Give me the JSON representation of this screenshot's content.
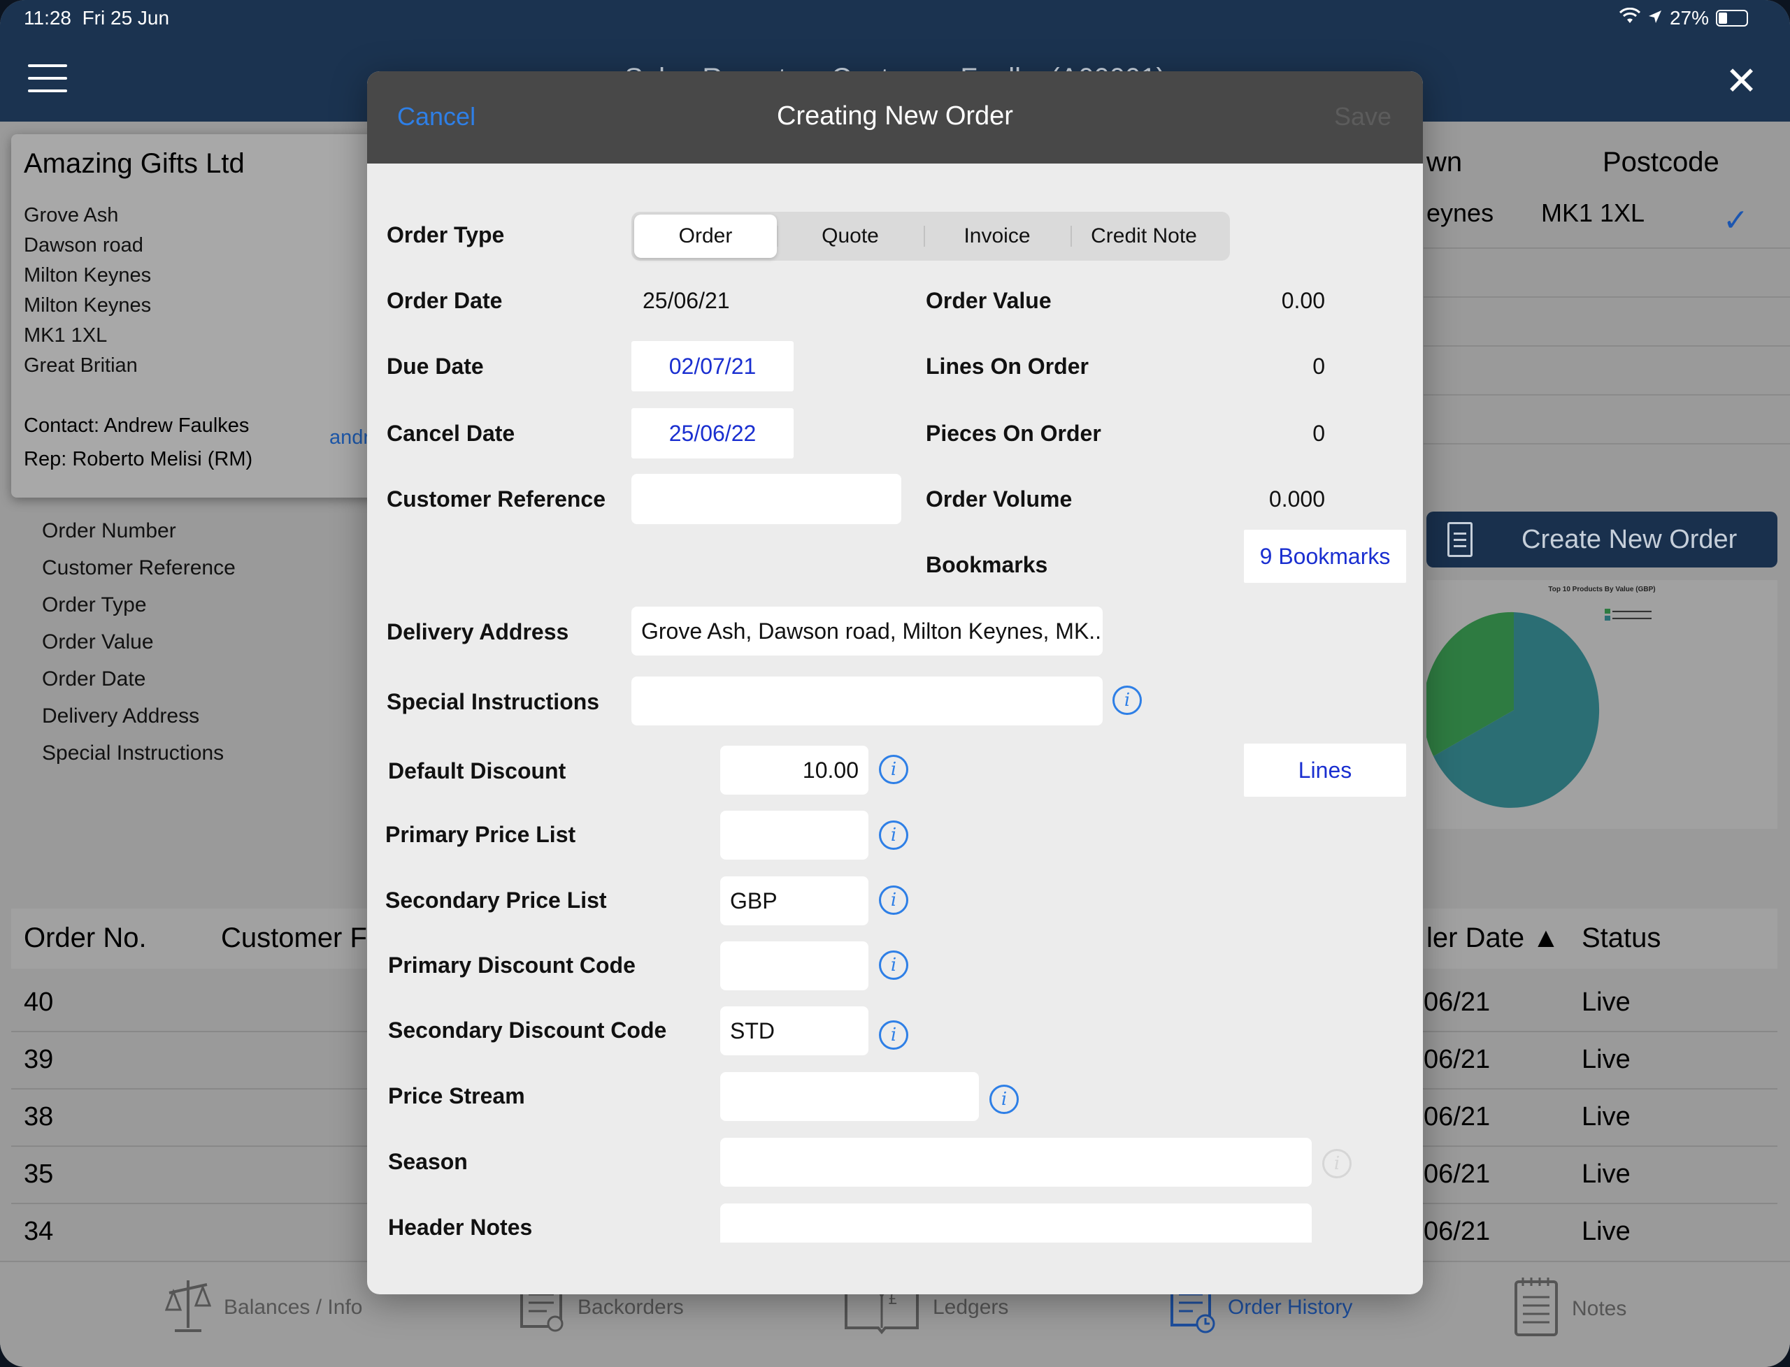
{
  "status_bar": {
    "time": "11:28",
    "date": "Fri 25 Jun",
    "battery": "27%"
  },
  "nav": {
    "title": "Sales Reports – Customer Faulks (A00001)"
  },
  "customer": {
    "name": "Amazing Gifts Ltd",
    "address_lines": [
      "Grove Ash",
      "Dawson road",
      "Milton Keynes",
      "Milton Keynes",
      "MK1 1XL",
      "Great Britian"
    ],
    "contact": "Contact: Andrew Faulkes",
    "email_partial": "andr",
    "rep": "Rep: Roberto Melisi (RM)"
  },
  "search_fields": [
    "Order Number",
    "Customer Reference",
    "Order Type",
    "Order Value",
    "Order Date",
    "Delivery Address",
    "Special Instructions"
  ],
  "address_table": {
    "town_header": "wn",
    "postcode_header": "Postcode",
    "town": "eynes",
    "postcode": "MK1 1XL"
  },
  "create_order_button": "Create New Order",
  "pie_chart": {
    "title": "Top 10 Products By Value (GBP)"
  },
  "orders_table": {
    "headers": {
      "order_no": "Order No.",
      "customer_ref": "Customer F",
      "order_date": "ler Date ▲",
      "status": "Status"
    },
    "rows": [
      {
        "no": "40",
        "date": "06/21",
        "status": "Live"
      },
      {
        "no": "39",
        "date": "06/21",
        "status": "Live"
      },
      {
        "no": "38",
        "date": "06/21",
        "status": "Live"
      },
      {
        "no": "35",
        "date": "06/21",
        "status": "Live"
      },
      {
        "no": "34",
        "date": "06/21",
        "status": "Live"
      }
    ]
  },
  "tabs": [
    {
      "label": "Balances / Info",
      "icon": "scales-icon",
      "active": false
    },
    {
      "label": "Backorders",
      "icon": "backorders-icon",
      "active": false
    },
    {
      "label": "Ledgers",
      "icon": "ledger-book-icon",
      "active": false
    },
    {
      "label": "Order History",
      "icon": "order-history-icon",
      "active": true
    },
    {
      "label": "Notes",
      "icon": "notepad-icon",
      "active": false
    }
  ],
  "modal": {
    "cancel": "Cancel",
    "title": "Creating New Order",
    "save": "Save",
    "order_type": {
      "label": "Order Type",
      "options": [
        "Order",
        "Quote",
        "Invoice",
        "Credit Note"
      ],
      "selected": "Order"
    },
    "order_date": {
      "label": "Order Date",
      "value": "25/06/21"
    },
    "due_date": {
      "label": "Due Date",
      "value": "02/07/21"
    },
    "cancel_date": {
      "label": "Cancel Date",
      "value": "25/06/22"
    },
    "customer_reference": {
      "label": "Customer Reference",
      "value": ""
    },
    "order_value": {
      "label": "Order Value",
      "value": "0.00"
    },
    "lines_on_order": {
      "label": "Lines On Order",
      "value": "0"
    },
    "pieces_on_order": {
      "label": "Pieces On Order",
      "value": "0"
    },
    "order_volume": {
      "label": "Order Volume",
      "value": "0.000"
    },
    "bookmarks": {
      "label": "Bookmarks",
      "button": "9 Bookmarks"
    },
    "delivery_address": {
      "label": "Delivery Address",
      "value": "Grove Ash, Dawson road, Milton Keynes, MK..."
    },
    "special_instructions": {
      "label": "Special Instructions",
      "value": ""
    },
    "default_discount": {
      "label": "Default Discount",
      "value": "10.00"
    },
    "lines_button": "Lines",
    "primary_price_list": {
      "label": "Primary Price List",
      "value": ""
    },
    "secondary_price_list": {
      "label": "Secondary Price List",
      "value": "GBP"
    },
    "primary_discount_code": {
      "label": "Primary Discount Code",
      "value": ""
    },
    "secondary_discount_code": {
      "label": "Secondary Discount Code",
      "value": "STD"
    },
    "price_stream": {
      "label": "Price Stream",
      "value": ""
    },
    "season": {
      "label": "Season",
      "value": ""
    },
    "header_notes": {
      "label": "Header Notes",
      "value": ""
    }
  },
  "colors": {
    "nav_blue": "#1b3350",
    "link_blue": "#2e7fe6",
    "value_blue": "#1a2fd0",
    "modal_header": "#484848"
  }
}
